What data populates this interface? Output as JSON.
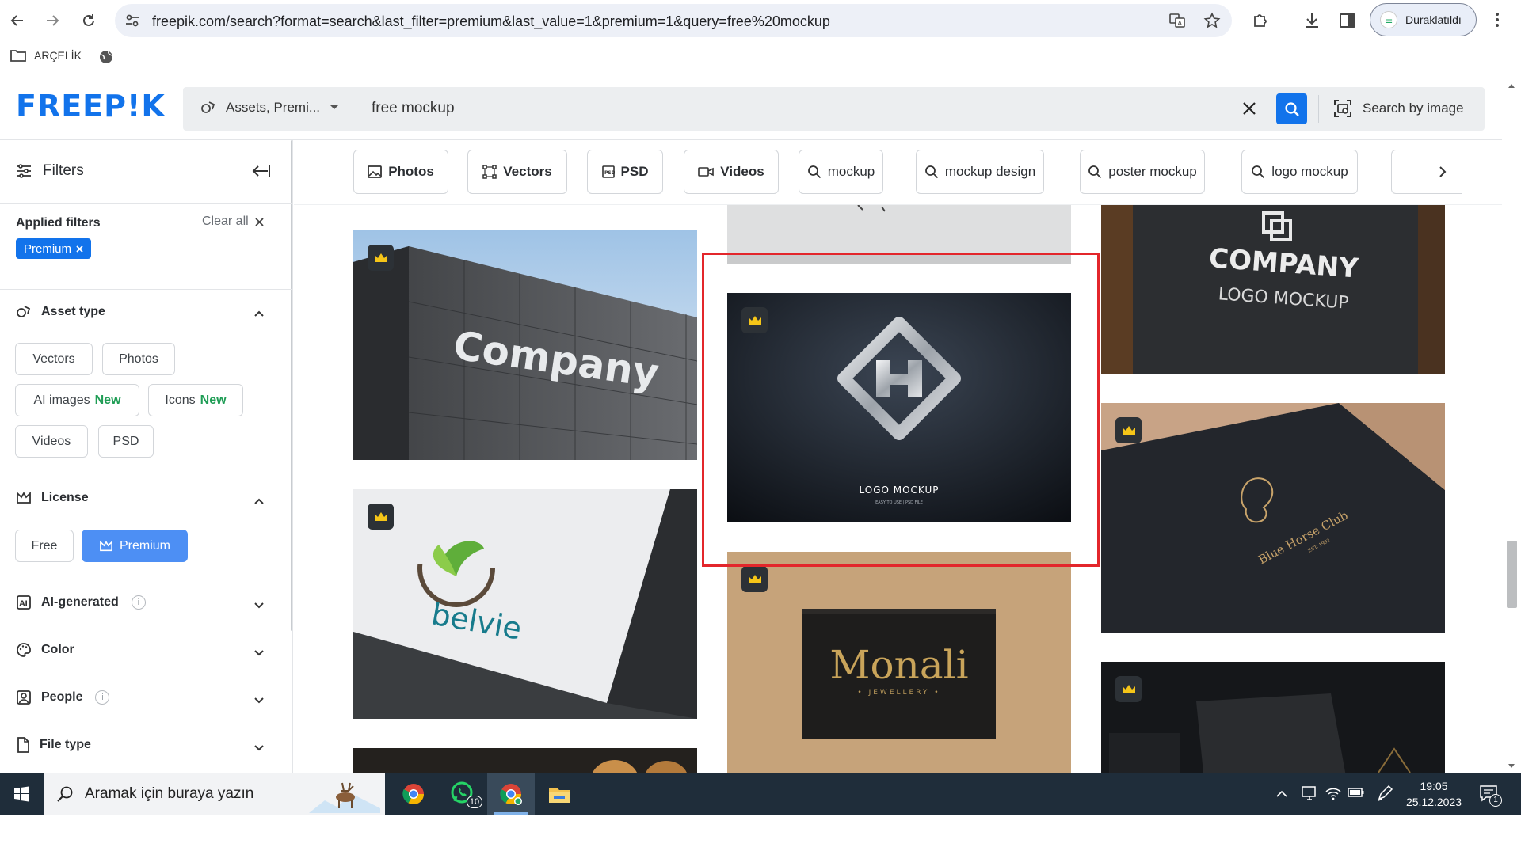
{
  "browser": {
    "url": "freepik.com/search?format=search&last_filter=premium&last_value=1&premium=1&query=free%20mockup",
    "profile_label": "Duraklatıldı",
    "bookmark_folder": "ARÇELİK"
  },
  "header": {
    "logo": "FREEP!K",
    "assets_dropdown": "Assets, Premi...",
    "search_query": "free mockup",
    "search_by_image": "Search by image"
  },
  "sidebar": {
    "title": "Filters",
    "applied_title": "Applied filters",
    "clear_all": "Clear all",
    "applied_chip": "Premium",
    "asset_type": {
      "title": "Asset type",
      "tags": [
        "Vectors",
        "Photos",
        "AI images",
        "Icons",
        "Videos",
        "PSD"
      ],
      "new_badge": "New"
    },
    "license": {
      "title": "License",
      "free": "Free",
      "premium": "Premium"
    },
    "ai_generated": "AI-generated",
    "color": "Color",
    "people": "People",
    "file_type": "File type",
    "info_glyph": "i"
  },
  "chips": {
    "photos": "Photos",
    "vectors": "Vectors",
    "psd": "PSD",
    "videos": "Videos",
    "mockup": "mockup",
    "mockup_design": "mockup design",
    "poster_mockup": "poster mockup",
    "logo_mockup": "logo mockup"
  },
  "gallery": {
    "company_sign": "Company",
    "belvie": "belvie",
    "logo_mockup_title": "LOGO MOCKUP",
    "logo_mockup_sub": "EASY TO USE | PSD FILE",
    "monali": "Monali",
    "monali_sub": "• JEWELLERY •",
    "company_logo_1": "COMPANY",
    "company_logo_2": "LOGO MOCKUP",
    "blue_horse": "Blue Horse Club",
    "blue_horse_est": "EST. 1992"
  },
  "taskbar": {
    "search_placeholder": "Aramak için buraya yazın",
    "whatsapp_badge": "10",
    "time": "19:05",
    "date": "25.12.2023",
    "notifications": "1"
  },
  "colors": {
    "brand": "#1273eb",
    "highlight": "#e3262b",
    "new_badge": "#1f9d55"
  }
}
